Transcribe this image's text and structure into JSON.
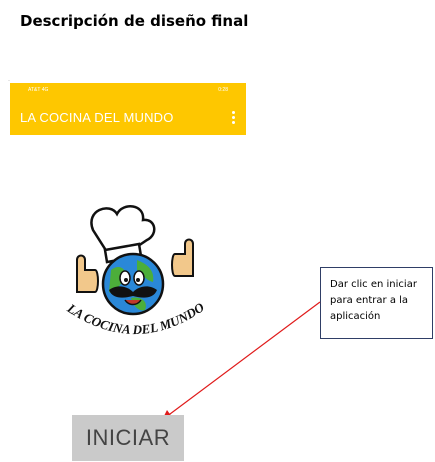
{
  "document": {
    "title": "Descripción de diseño final"
  },
  "status_bar": {
    "left": "AT&T 4G",
    "right": "0:28"
  },
  "app_bar": {
    "title": "LA COCINA DEL MUNDO",
    "menu_icon": "more-vert-icon",
    "color": "#fec700"
  },
  "logo": {
    "text": "LA COCINA DEL MUNDO",
    "icon": "chef-globe-logo"
  },
  "callout": {
    "text": "Dar clic en iniciar para entrar a la aplicación",
    "arrow_color": "#e01b1b"
  },
  "start_button": {
    "label": "INICIAR"
  }
}
